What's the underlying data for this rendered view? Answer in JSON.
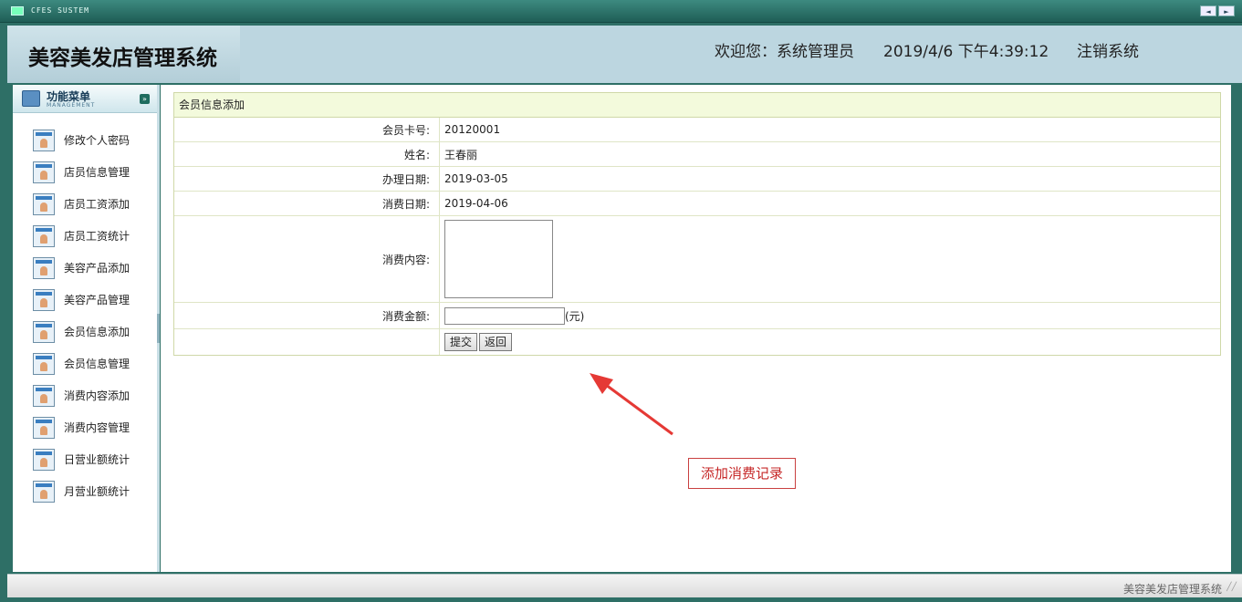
{
  "titlebar": {
    "app_title": "CFES SUSTEM",
    "prev_label": "◄",
    "next_label": "►"
  },
  "header": {
    "system_title": "美容美发店管理系统",
    "welcome": "欢迎您：系统管理员",
    "datetime": "2019/4/6 下午4:39:12",
    "logout": "注销系统"
  },
  "menu": {
    "title": "功能菜单",
    "subtitle": "MANAGEMENT",
    "items": [
      {
        "label": "修改个人密码"
      },
      {
        "label": "店员信息管理"
      },
      {
        "label": "店员工资添加"
      },
      {
        "label": "店员工资统计"
      },
      {
        "label": "美容产品添加"
      },
      {
        "label": "美容产品管理"
      },
      {
        "label": "会员信息添加"
      },
      {
        "label": "会员信息管理"
      },
      {
        "label": "消费内容添加"
      },
      {
        "label": "消费内容管理"
      },
      {
        "label": "日营业额统计"
      },
      {
        "label": "月营业额统计"
      }
    ]
  },
  "form": {
    "caption": "会员信息添加",
    "card_label": "会员卡号:",
    "card_value": "20120001",
    "name_label": "姓名:",
    "name_value": "王春丽",
    "join_label": "办理日期:",
    "join_value": "2019-03-05",
    "consume_date_label": "消费日期:",
    "consume_date_value": "2019-04-06",
    "content_label": "消费内容:",
    "content_value": "",
    "amount_label": "消费金额:",
    "amount_value": "",
    "amount_unit": "(元)",
    "submit_label": "提交",
    "back_label": "返回"
  },
  "annotation": {
    "text": "添加消费记录",
    "color": "#c62828"
  },
  "statusbar": {
    "text": "美容美发店管理系统"
  },
  "colors": {
    "frame": "#2e6f66",
    "header_bg": "#bcd6e0",
    "form_caption_bg": "#f3fadc"
  }
}
